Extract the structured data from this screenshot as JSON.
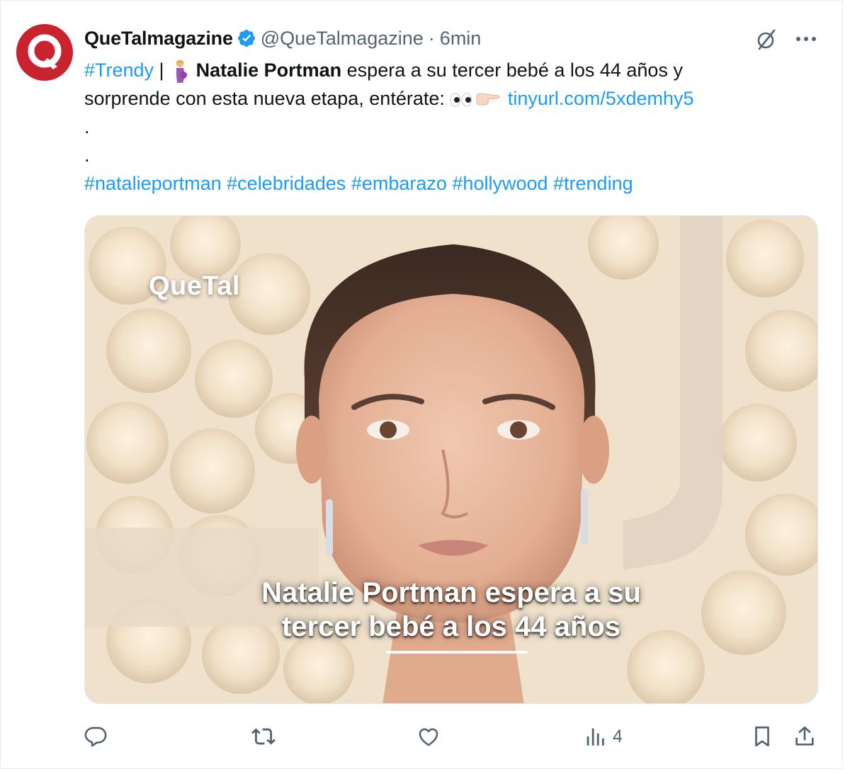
{
  "tweet": {
    "author_name": "QueTalmagazine",
    "handle": "@QueTalmagazine",
    "separator": "·",
    "time": "6min",
    "avatar_letter": "Q",
    "text": {
      "hashtag_trendy": "#Trendy",
      "pipe": " | ",
      "bold_name": "Natalie Portman",
      "line1_rest": " espera a su tercer bebé a los 44 años y",
      "line2": "sorprende con esta nueva etapa, entérate: ",
      "url": "tinyurl.com/5xdemhy5",
      "dot1": ".",
      "dot2": ".",
      "hashtags": [
        "#natalieportman",
        "#celebridades",
        "#embarazo",
        "#hollywood",
        "#trending"
      ]
    },
    "media": {
      "watermark": "QueTal",
      "caption_line1": "Natalie Portman espera a su",
      "caption_line2": "tercer bebé a los 44 años"
    },
    "actions": {
      "reply_icon": "reply-icon",
      "retweet_icon": "retweet-icon",
      "like_icon": "like-icon",
      "views_icon": "views-icon",
      "views_count": "4",
      "bookmark_icon": "bookmark-icon",
      "share_icon": "share-icon"
    }
  },
  "colors": {
    "link": "#1d9bf0",
    "text": "#0f1419",
    "secondary": "#536471",
    "brand_red": "#c9232f"
  }
}
